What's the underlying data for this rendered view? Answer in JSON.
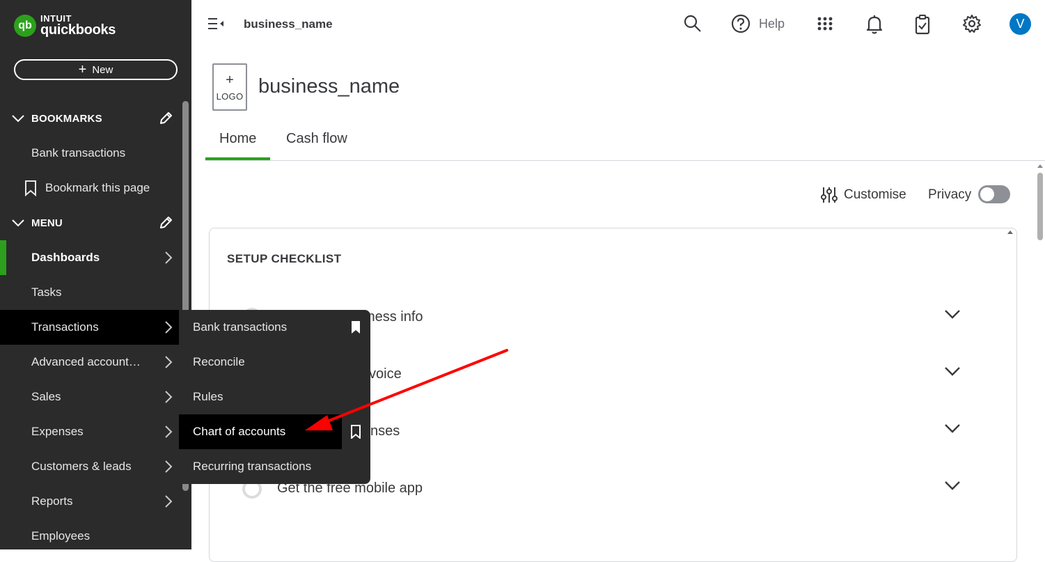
{
  "brand": {
    "top": "INTUIT",
    "bottom": "quickbooks",
    "mark": "qb"
  },
  "sidebar": {
    "new_label": "New",
    "bookmarks_header": "BOOKMARKS",
    "bookmarks": [
      {
        "label": "Bank transactions"
      },
      {
        "label": "Bookmark this page",
        "icon": "bookmark-outline-icon"
      }
    ],
    "menu_header": "MENU",
    "items": [
      {
        "label": "Dashboards",
        "active": true,
        "has_arrow": true
      },
      {
        "label": "Tasks",
        "has_arrow": false
      },
      {
        "label": "Transactions",
        "has_arrow": true,
        "hover": true
      },
      {
        "label": "Advanced account…",
        "has_arrow": true
      },
      {
        "label": "Sales",
        "has_arrow": true
      },
      {
        "label": "Expenses",
        "has_arrow": true
      },
      {
        "label": "Customers & leads",
        "has_arrow": true
      },
      {
        "label": "Reports",
        "has_arrow": true
      },
      {
        "label": "Employees",
        "has_arrow": false
      }
    ]
  },
  "flyout": {
    "items": [
      {
        "label": "Bank transactions",
        "bookmark": "filled"
      },
      {
        "label": "Reconcile"
      },
      {
        "label": "Rules"
      },
      {
        "label": "Chart of accounts",
        "bookmark": "outline",
        "highlighted": true
      },
      {
        "label": "Recurring transactions"
      }
    ]
  },
  "topbar": {
    "business_name": "business_name",
    "help_label": "Help",
    "avatar_initial": "V"
  },
  "header": {
    "logo_plus": "+",
    "logo_label": "LOGO",
    "title": "business_name",
    "tabs": [
      {
        "label": "Home",
        "active": true
      },
      {
        "label": "Cash flow",
        "active": false
      }
    ]
  },
  "toolbar": {
    "customise_label": "Customise",
    "privacy_label": "Privacy"
  },
  "checklist": {
    "title": "SETUP CHECKLIST",
    "rows": [
      {
        "label": "iness info"
      },
      {
        "label": "voice"
      },
      {
        "label": "nses"
      },
      {
        "label": "Get the free mobile app"
      }
    ]
  },
  "colors": {
    "brand_green": "#2ca01c",
    "sidebar_bg": "#2b2b2b",
    "avatar_blue": "#0077c5",
    "annotation_red": "#ff0000"
  }
}
